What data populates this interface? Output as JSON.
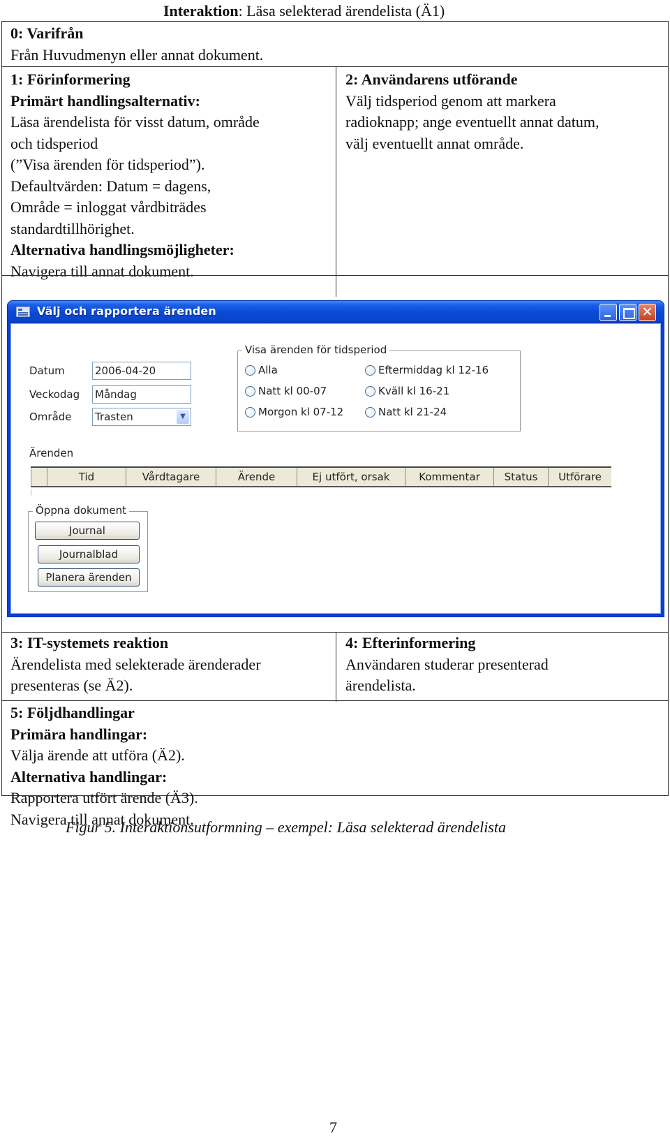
{
  "document": {
    "title_bold": "Interaktion",
    "title_rest": ": Läsa selekterad ärendelista (Ä1)",
    "sections": {
      "s0": {
        "heading": "0: Varifrån",
        "lines": [
          "Från Huvudmenyn eller annat dokument."
        ]
      },
      "s1": {
        "heading": "1: Förinformering",
        "sub1": "Primärt handlingsalternativ:",
        "lines1": [
          "Läsa ärendelista för visst datum, område",
          "och tidsperiod",
          "(”Visa ärenden för tidsperiod”).",
          "Defaultvärden: Datum = dagens,",
          "Område = inloggat vårdbiträdes",
          "standardtillhörighet."
        ],
        "sub2": "Alternativa handlingsmöjligheter:",
        "lines2": [
          "Navigera till annat dokument."
        ]
      },
      "s2": {
        "heading": "2: Användarens utförande",
        "lines": [
          "Välj tidsperiod genom att markera",
          "radioknapp; ange eventuellt annat datum,",
          "välj eventuellt annat område."
        ]
      },
      "s3": {
        "heading": "3: IT-systemets reaktion",
        "lines": [
          "Ärendelista med selekterade ärenderader",
          "presenteras (se Ä2)."
        ]
      },
      "s4": {
        "heading": "4: Efterinformering",
        "lines": [
          "Användaren studerar presenterad",
          "ärendelista."
        ]
      },
      "s5": {
        "heading": "5: Följdhandlingar",
        "sub1": "Primära handlingar:",
        "lines1": [
          "Välja ärende att utföra (Ä2)."
        ],
        "sub2": "Alternativa handlingar:",
        "lines2": [
          "Rapportera utfört ärende (Ä3).",
          "Navigera till annat dokument."
        ]
      }
    },
    "caption": "Figur 5. Interaktionsutformning – exempel: Läsa selekterad ärendelista",
    "page_number": "7"
  },
  "window": {
    "title": "Välj och rapportera ärenden",
    "close_glyph": "✕",
    "fields": {
      "datum_label": "Datum",
      "datum_value": "2006-04-20",
      "veckodag_label": "Veckodag",
      "veckodag_value": "Måndag",
      "omrade_label": "Område",
      "omrade_value": "Trasten",
      "dropdown_glyph": "▼"
    },
    "period_group": {
      "legend": "Visa ärenden för tidsperiod",
      "options": [
        "Alla",
        "Natt kl 00-07",
        "Morgon kl 07-12",
        "Eftermiddag kl 12-16",
        "Kväll kl 16-21",
        "Natt kl 21-24"
      ]
    },
    "arenden": {
      "label": "Ärenden",
      "columns": [
        "Tid",
        "Vårdtagare",
        "Ärende",
        "Ej utfört, orsak",
        "Kommentar",
        "Status",
        "Utförare"
      ]
    },
    "open_docs": {
      "legend": "Öppna dokument",
      "buttons": [
        "Journal",
        "Journalblad",
        "Planera ärenden"
      ]
    }
  }
}
